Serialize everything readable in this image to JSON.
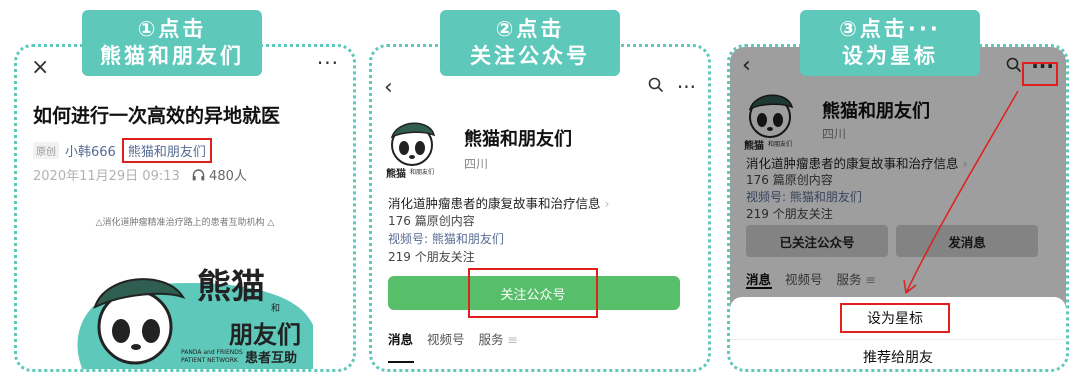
{
  "steps": [
    {
      "line1": "①点击",
      "line2": "熊猫和朋友们"
    },
    {
      "line1": "②点击",
      "line2": "关注公众号"
    },
    {
      "line1": "③点击···",
      "line2": "设为星标"
    }
  ],
  "article": {
    "close_icon": "×",
    "more_icon": "···",
    "title": "如何进行一次高效的异地就医",
    "original_tag": "原创",
    "author": "小韩666",
    "account": "熊猫和朋友们",
    "date": "2020年11月29日 09:13",
    "listen_icon": "headphones-icon",
    "listens": "480人",
    "caption": "△消化道肿瘤精准治疗路上的患者互助机构 △",
    "logo": {
      "big_text": "熊猫",
      "small_and": "和",
      "friends_text": "朋友们",
      "en_line1": "PANDA and FRIENDS",
      "en_line2": "PATIENT NETWORK",
      "mutual_text": "患者互助"
    }
  },
  "profile": {
    "back_icon": "‹",
    "search_icon": "search-icon",
    "more_icon": "···",
    "name": "熊猫和朋友们",
    "region": "四川",
    "desc": "消化道肿瘤患者的康复故事和治疗信息",
    "desc_chevron": "›",
    "count": "176 篇原创内容",
    "video": "视频号: 熊猫和朋友们",
    "friends": "219 个朋友关注",
    "follow_label": "关注公众号",
    "tabs": [
      "消息",
      "视频号",
      "服务"
    ],
    "tab_menu_icon": "≡",
    "avatar_text": "熊猫",
    "avatar_small": "和朋友们"
  },
  "profile3": {
    "followed_label": "已关注公众号",
    "message_label": "发消息",
    "sheet_star": "设为星标",
    "sheet_recommend": "推荐给朋友"
  },
  "colors": {
    "accent": "#5ec8bb",
    "follow_green": "#57be6a",
    "highlight_red": "#e0201c",
    "link_blue": "#576b95"
  }
}
